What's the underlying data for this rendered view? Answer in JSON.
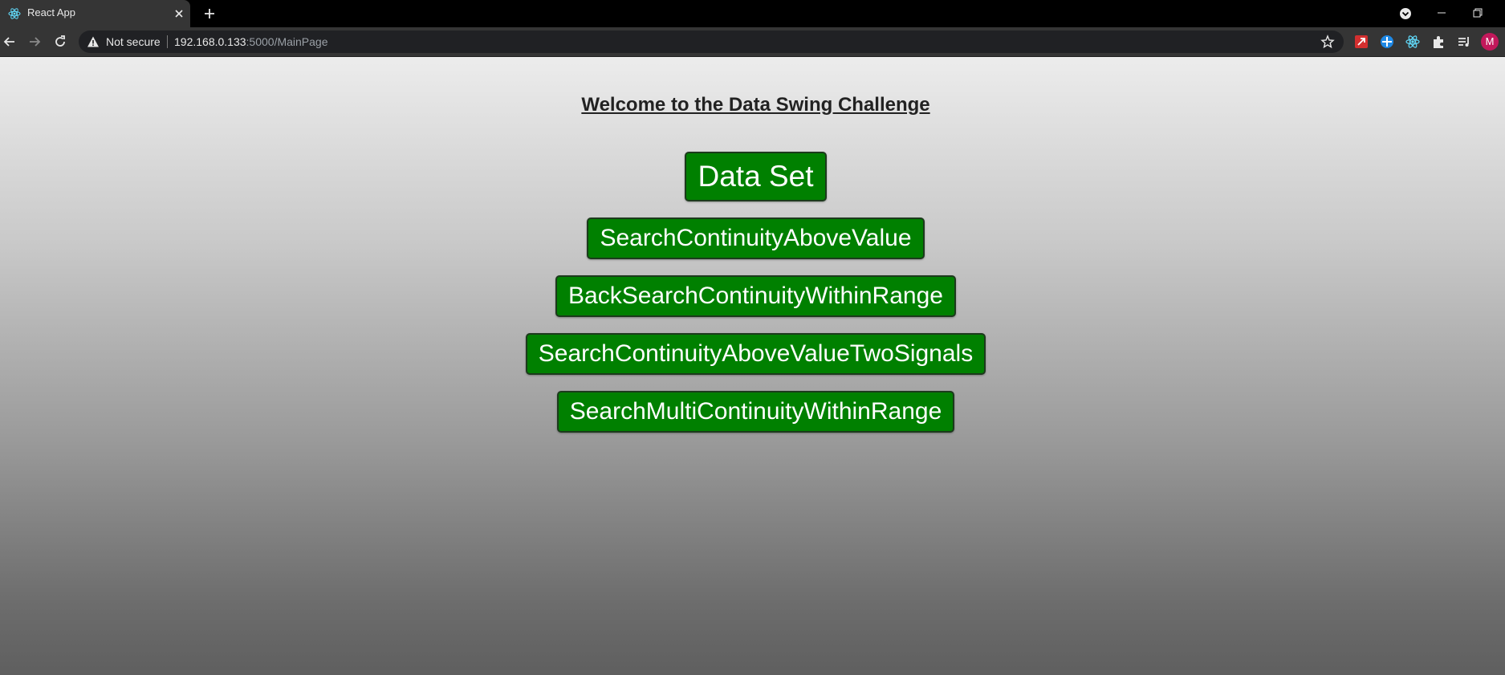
{
  "browser": {
    "tab": {
      "title": "React App",
      "favicon": "react-atom-icon"
    },
    "toolbar": {
      "security_label": "Not secure",
      "url_host": "192.168.0.133",
      "url_path": ":5000/MainPage",
      "avatar_initial": "M"
    }
  },
  "page": {
    "heading": "Welcome to the Data Swing Challenge",
    "buttons": {
      "data_set": "Data Set",
      "search_above_value": "SearchContinuityAboveValue",
      "back_search_within_range": "BackSearchContinuityWithinRange",
      "search_above_value_two_signals": "SearchContinuityAboveValueTwoSignals",
      "search_multi_within_range": "SearchMultiContinuityWithinRange"
    }
  },
  "colors": {
    "button_green": "#008000",
    "button_text": "#ffffff",
    "heading_text": "#222222"
  }
}
